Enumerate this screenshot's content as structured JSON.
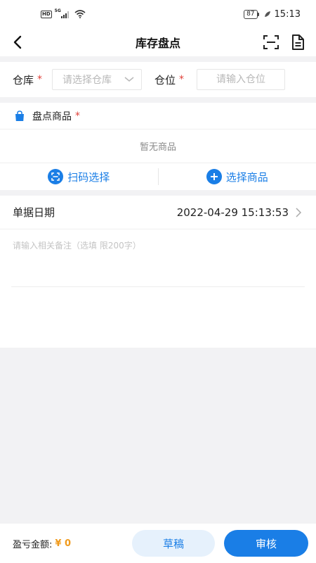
{
  "status_bar": {
    "hd_badge": "HD",
    "network": "5G",
    "battery": "87",
    "time": "15:13"
  },
  "nav": {
    "title": "库存盘点",
    "icons": [
      "back-icon",
      "scan-icon",
      "document-icon"
    ]
  },
  "warehouse": {
    "label": "仓库",
    "required_mark": "*",
    "placeholder": "请选择仓库"
  },
  "location": {
    "label": "仓位",
    "required_mark": "*",
    "placeholder": "请输入仓位",
    "value": ""
  },
  "goods": {
    "title": "盘点商品",
    "required_mark": "*",
    "empty_text": "暂无商品",
    "scan_select_label": "扫码选择",
    "choose_goods_label": "选择商品"
  },
  "document": {
    "date_label": "单据日期",
    "date_value": "2022-04-29 15:13:53",
    "remark_placeholder": "请输入相关备注（选填 限200字）",
    "remark_value": ""
  },
  "footer": {
    "profit_label": "盈亏金额:",
    "profit_value": "¥ 0",
    "draft_label": "草稿",
    "audit_label": "审核"
  },
  "colors": {
    "accent": "#1a7ee6",
    "required": "#e0413a",
    "profit": "#f09a1c",
    "background": "#f2f2f4"
  }
}
